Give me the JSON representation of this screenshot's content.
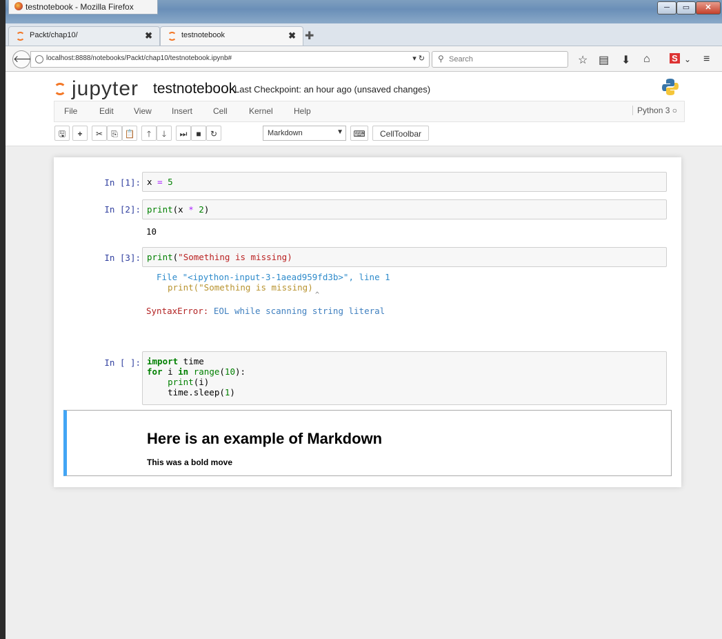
{
  "window": {
    "title": "testnotebook - Mozilla Firefox",
    "controls": [
      "─",
      "▭",
      "✕"
    ]
  },
  "tabs": [
    {
      "label": "Packt/chap10/",
      "active": false
    },
    {
      "label": "testnotebook",
      "active": true
    }
  ],
  "nav": {
    "url": "localhost:8888/notebooks/Packt/chap10/testnotebook.ipynb#",
    "search_placeholder": "Search"
  },
  "jupyter": {
    "logo_text": "jupyter",
    "notebook_name": "testnotebook",
    "checkpoint": "Last Checkpoint: an hour ago (unsaved changes)",
    "menu": [
      "File",
      "Edit",
      "View",
      "Insert",
      "Cell",
      "Kernel",
      "Help"
    ],
    "kernel": "Python 3",
    "cell_type": "Markdown",
    "celltoolbar_label": "CellToolbar"
  },
  "cells": {
    "c1": {
      "prompt": "In [1]:"
    },
    "c2": {
      "prompt": "In [2]:",
      "output": "10"
    },
    "c3": {
      "prompt": "In [3]:",
      "tb_file": "File \"<ipython-input-3-1aead959fd3b>\", line 1",
      "tb_code": "print(\"Something is missing)",
      "tb_caret": "^",
      "err_type": "SyntaxError:",
      "err_msg": "EOL while scanning string literal"
    },
    "c4": {
      "prompt": "In [ ]:"
    }
  },
  "markdown": {
    "heading": "Here is an example of Markdown",
    "body": "This was a bold move"
  }
}
